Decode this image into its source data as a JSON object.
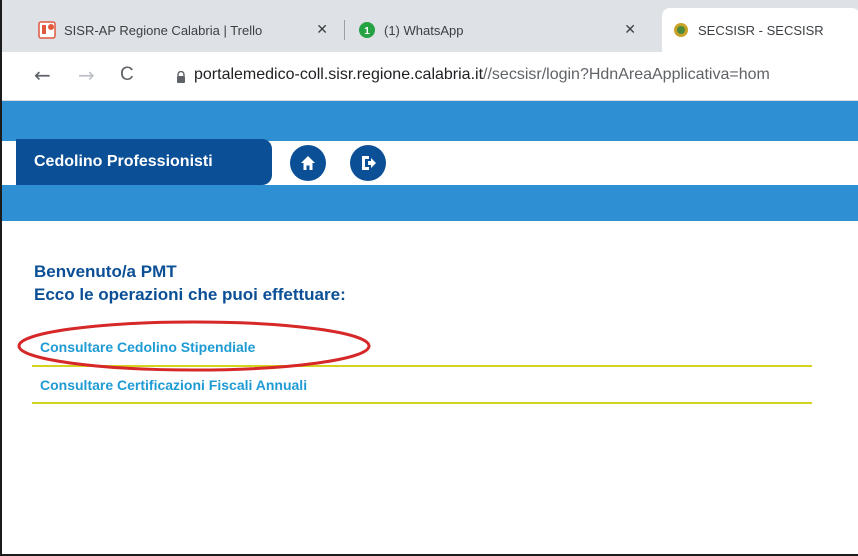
{
  "browser": {
    "tabs": [
      {
        "title": "SISR-AP Regione Calabria | Trello",
        "close": "✕",
        "active": false
      },
      {
        "title": "(1) WhatsApp",
        "close": "✕",
        "active": false
      },
      {
        "title": "SECSISR - SECSISR",
        "close": "✕",
        "active": true
      }
    ],
    "url_host": "portalemedico-coll.sisr.regione.calabria.it",
    "url_path": "//secsisr/login?HdnAreaApplicativa=hom",
    "nav": {
      "back": "←",
      "forward": "→",
      "reload": "C"
    },
    "icons": {
      "lock": "lock-icon",
      "trello": "trello-icon",
      "whatsapp": "whatsapp-icon",
      "site": "seal-icon"
    }
  },
  "site": {
    "app_title": "Cedolino Professionisti",
    "icons": {
      "home": "home-icon",
      "logout": "logout-icon"
    }
  },
  "content": {
    "welcome": "Benvenuto/a PMT",
    "operations_heading": "Ecco le operazioni che puoi effettuare:",
    "links": [
      {
        "label": "Consultare Cedolino Stipendiale",
        "highlighted": true
      },
      {
        "label": "Consultare Certificazioni Fiscali Annuali",
        "highlighted": false
      }
    ]
  },
  "colors": {
    "accent": "#2e8fd3",
    "brand_dark": "#0b4f96",
    "link": "#1f9bd4",
    "rule": "#d4d41f",
    "highlight_ring": "#d62828"
  }
}
